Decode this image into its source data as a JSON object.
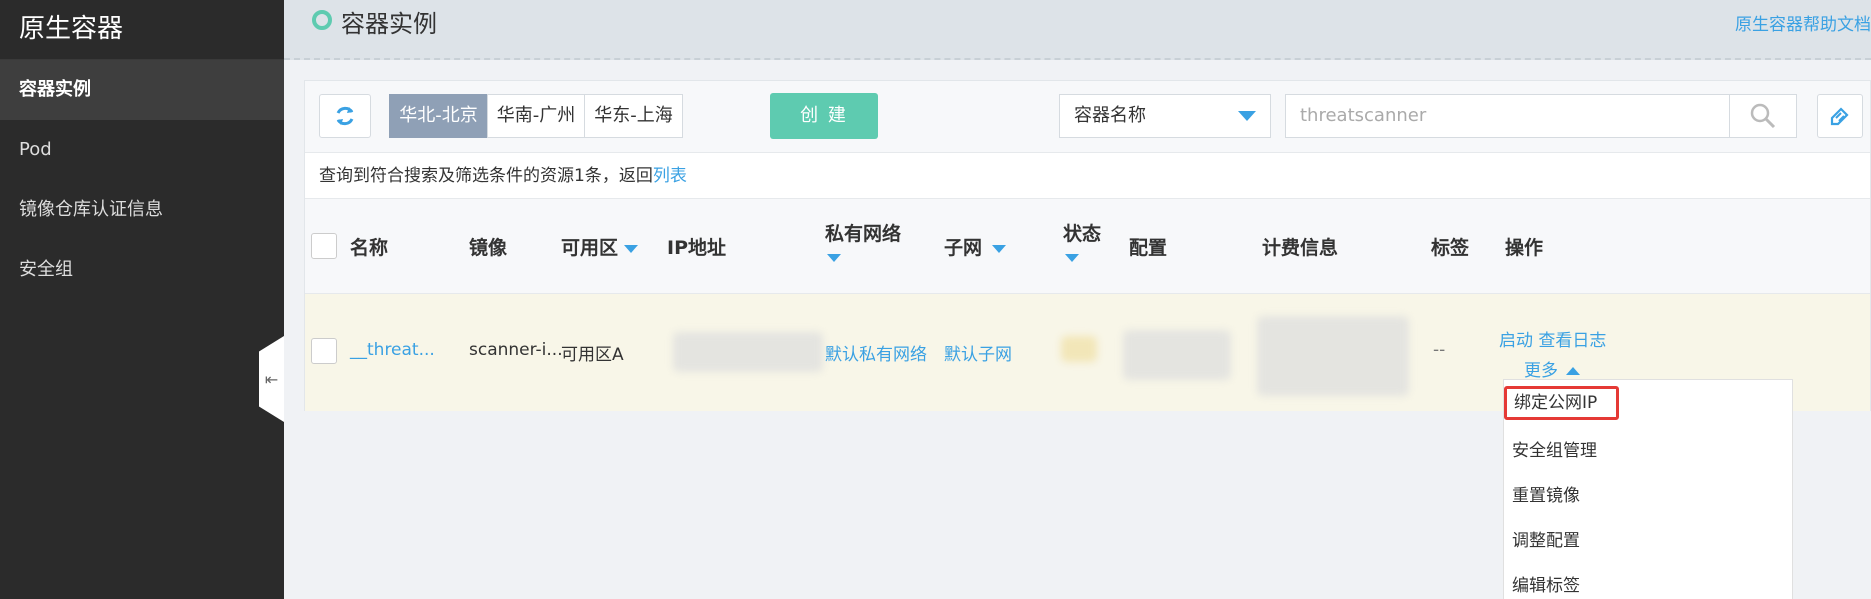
{
  "sidebar": {
    "brand": "原生容器",
    "items": [
      {
        "label": "容器实例",
        "active": true
      },
      {
        "label": "Pod"
      },
      {
        "label": "镜像仓库认证信息"
      },
      {
        "label": "安全组"
      }
    ],
    "collapse_icon": "collapse-left-icon"
  },
  "header": {
    "title": "容器实例",
    "help_link": "原生容器帮助文档"
  },
  "toolbar": {
    "regions": [
      "华北-北京",
      "华南-广州",
      "华东-上海"
    ],
    "active_region": "华北-北京",
    "create_label": "创 建",
    "filter_select": "容器名称",
    "search_value": "threatscanner"
  },
  "result": {
    "text": "查询到符合搜索及筛选条件的资源1条，返回",
    "link": "列表"
  },
  "table": {
    "headers": {
      "name": "名称",
      "image": "镜像",
      "zone": "可用区",
      "ip": "IP地址",
      "vpc": "私有网络",
      "subnet": "子网",
      "status": "状态",
      "config": "配置",
      "billing": "计费信息",
      "tags": "标签",
      "actions": "操作"
    },
    "row": {
      "name": "__threat...",
      "image": "scanner-i...",
      "zone": "可用区A",
      "vpc": "默认私有网络",
      "subnet": "默认子网",
      "tags": "--",
      "action_start": "启动",
      "action_logs": "查看日志",
      "action_more": "更多"
    }
  },
  "menu": {
    "items": [
      "绑定公网IP",
      "安全组管理",
      "重置镜像",
      "调整配置",
      "编辑标签"
    ]
  },
  "colors": {
    "accent": "#3aa1e3",
    "create": "#5ecbb0",
    "highlight": "#e53935",
    "sidebar": "#2b2b2b"
  }
}
